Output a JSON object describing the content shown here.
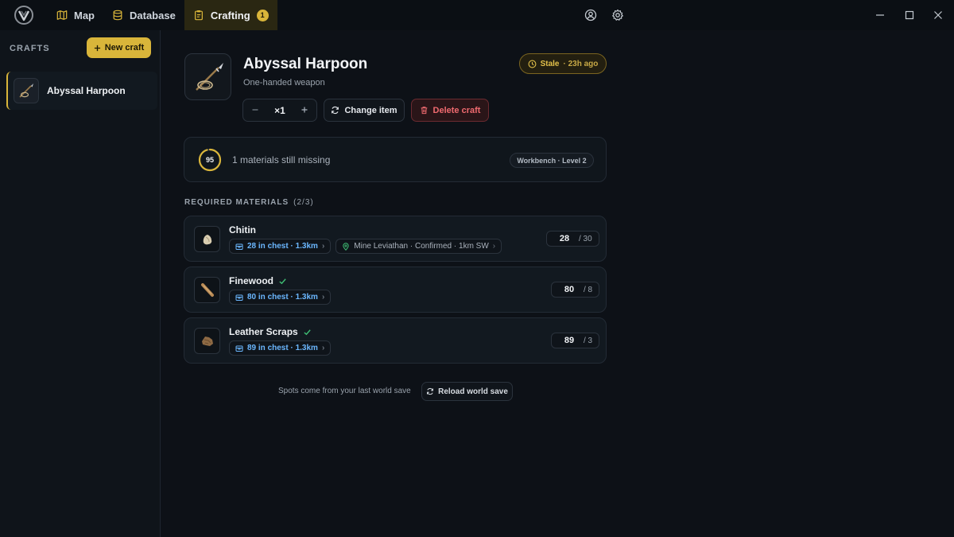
{
  "nav": {
    "tabs": [
      {
        "label": "Map",
        "icon": "map-icon"
      },
      {
        "label": "Database",
        "icon": "database-icon"
      },
      {
        "label": "Crafting",
        "icon": "clipboard-icon",
        "badge": "1",
        "active": true
      }
    ]
  },
  "sidebar": {
    "title": "CRAFTS",
    "new_craft_label": "New craft",
    "items": [
      {
        "label": "Abyssal Harpoon",
        "selected": true
      }
    ]
  },
  "craft": {
    "name": "Abyssal Harpoon",
    "category": "One-handed weapon",
    "status": {
      "label": "Stale",
      "age": "· 23h ago"
    },
    "quantity": "×1",
    "change_item_label": "Change item",
    "delete_label": "Delete craft"
  },
  "progress": {
    "value": "95",
    "percent": 95,
    "missing_text": "1 materials still missing",
    "station": "Workbench · Level 2"
  },
  "materials": {
    "title": "REQUIRED MATERIALS",
    "count": "(2/3)",
    "items": [
      {
        "name": "Chitin",
        "complete": false,
        "chest": "28 in chest · 1.3km",
        "source": "Mine Leviathan · Confirmed · 1km SW",
        "have": "28",
        "need": "/ 30"
      },
      {
        "name": "Finewood",
        "complete": true,
        "chest": "80 in chest · 1.3km",
        "have": "80",
        "need": "/ 8"
      },
      {
        "name": "Leather Scraps",
        "complete": true,
        "chest": "89 in chest · 1.3km",
        "have": "89",
        "need": "/ 3"
      }
    ]
  },
  "footer": {
    "note": "Spots come from your last world save",
    "reload_label": "Reload world save"
  },
  "colors": {
    "accent": "#d9b53a",
    "link": "#6bb7ff",
    "success": "#3fbf74",
    "danger": "#ef6a6f"
  }
}
